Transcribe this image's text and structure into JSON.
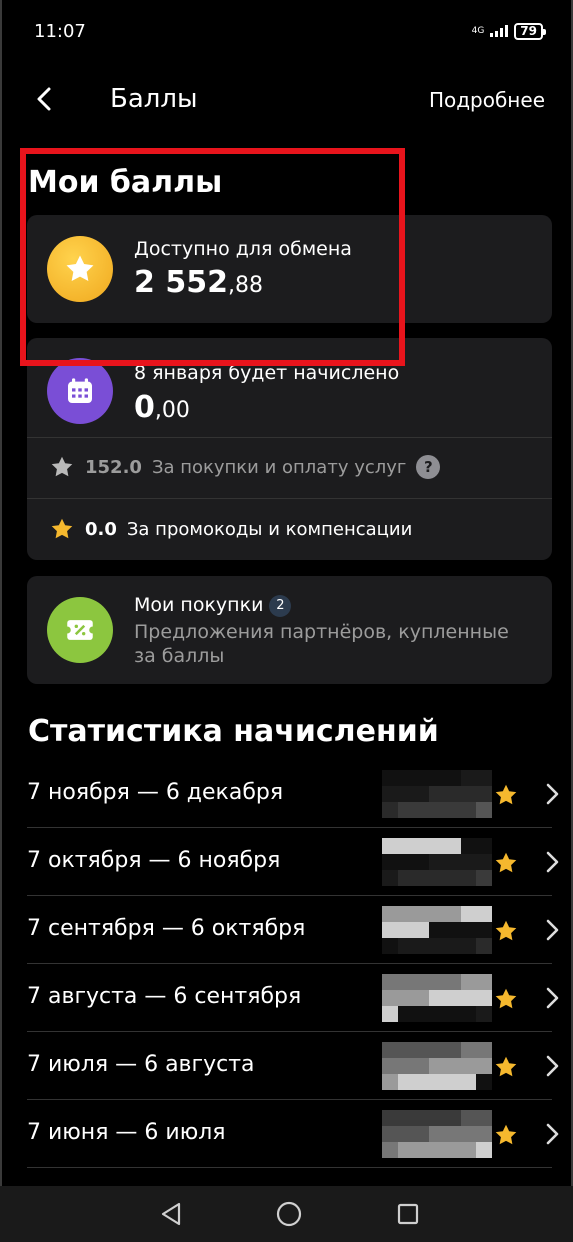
{
  "status_bar": {
    "time": "11:07",
    "network": "4G",
    "battery": "79"
  },
  "header": {
    "title": "Баллы",
    "more_link": "Подробнее"
  },
  "my_points": {
    "title": "Мои баллы",
    "available": {
      "label": "Доступно для обмена",
      "value_int": "2 552",
      "value_frac": ",88"
    },
    "pending": {
      "label": "8 января будет начислено",
      "value_int": "0",
      "value_frac": ",00"
    },
    "purchases_row": {
      "amount": "152.0",
      "label": "За покупки и оплату услуг",
      "help": "?"
    },
    "promo_row": {
      "amount": "0.0",
      "label": "За промокоды и компенсации"
    }
  },
  "my_purchases": {
    "title": "Мои покупки",
    "count": "2",
    "subtitle": "Предложения партнёров, купленные за баллы"
  },
  "statistics": {
    "title": "Статистика начислений",
    "periods": [
      {
        "label": "7 ноября — 6 декабря"
      },
      {
        "label": "7 октября — 6 ноября"
      },
      {
        "label": "7 сентября — 6 октября"
      },
      {
        "label": "7 августа — 6 сентября"
      },
      {
        "label": "7 июля — 6 августа"
      },
      {
        "label": "7 июня — 6 июля"
      }
    ]
  },
  "colors": {
    "background": "#000000",
    "card": "#1c1c1e",
    "star_yellow": "#f5b82e",
    "calendar_purple": "#7a4ed6",
    "purchases_green": "#8cc63f",
    "highlight_red": "#e8141c"
  },
  "icons": {
    "back": "chevron-left-icon",
    "available": "star-coin-icon",
    "pending": "calendar-icon",
    "purchases": "ticket-icon",
    "row_star": "star-icon",
    "row_chevron": "chevron-right-icon"
  }
}
